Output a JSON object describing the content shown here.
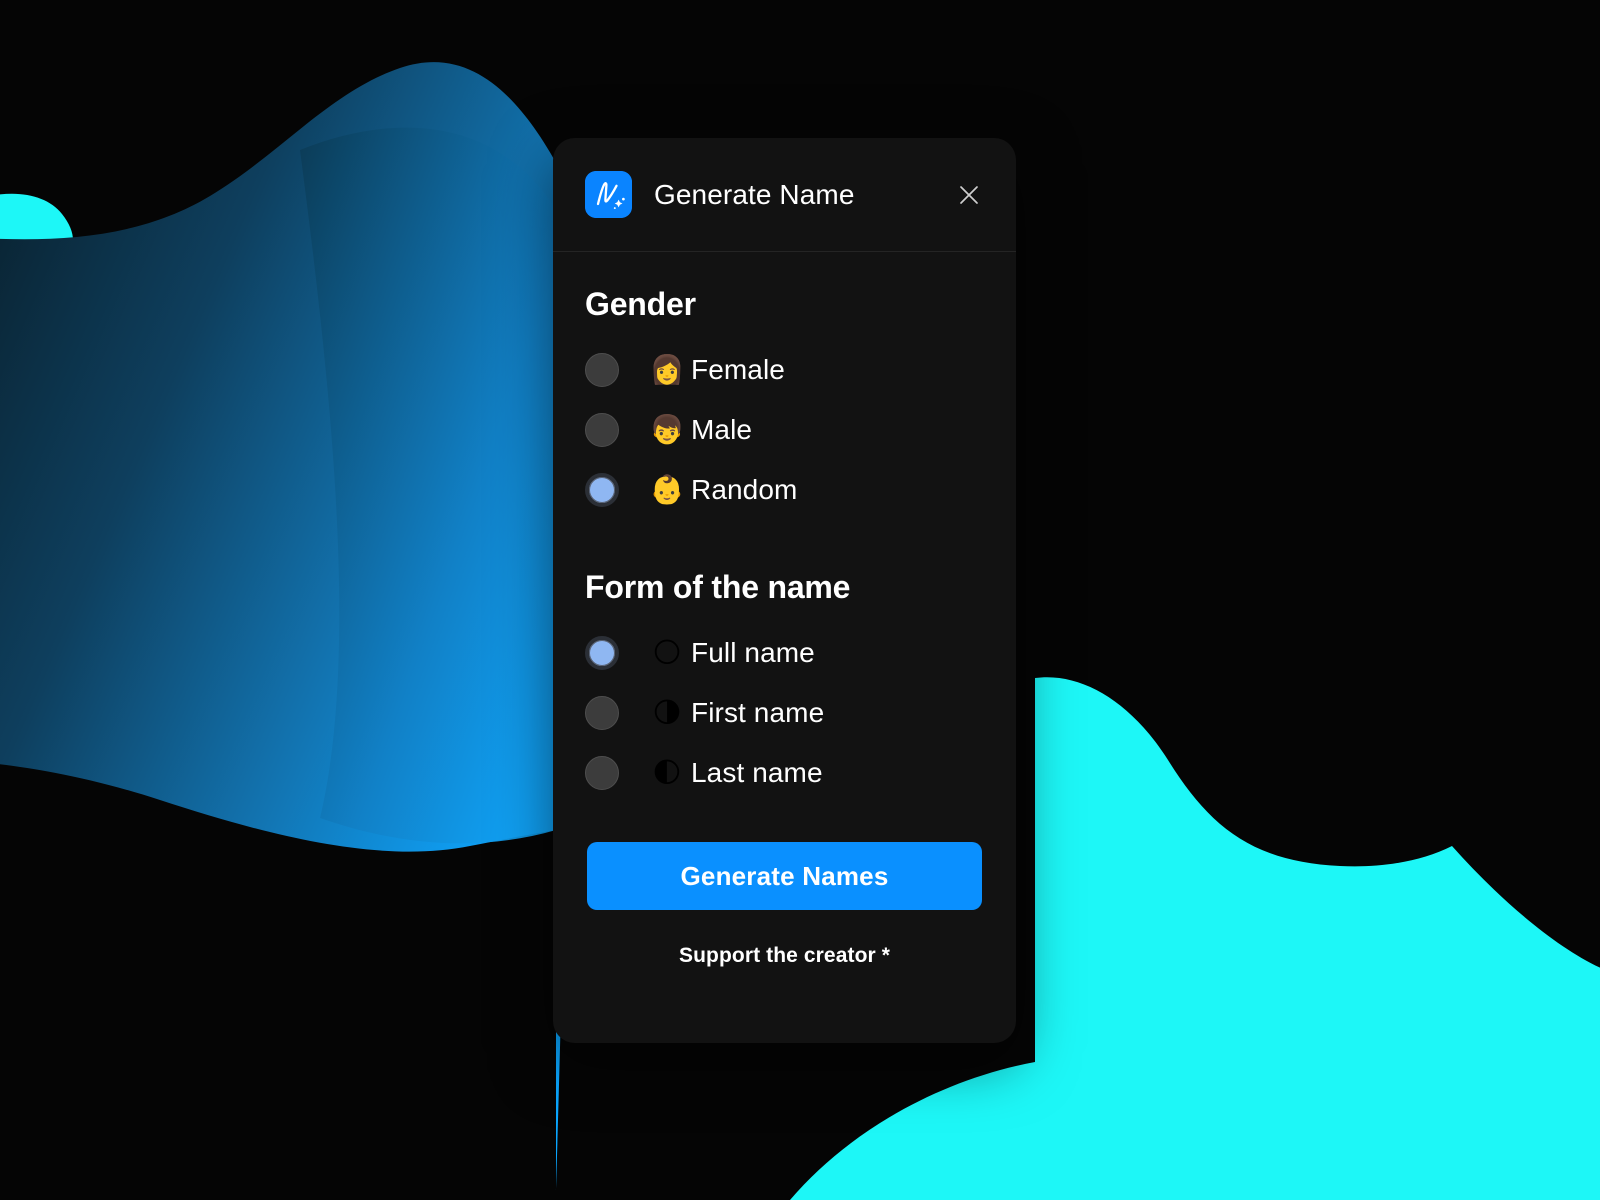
{
  "background": {
    "page_color": "#050505",
    "wave_blue_dark": "#0C2B3E",
    "wave_blue_mid": "#11689F",
    "wave_blue_bright": "#0DA2FF",
    "wave_cyan": "#1DF7F7"
  },
  "panel": {
    "background_color": "#121212",
    "header": {
      "logo_icon": "name-generator-logo-icon",
      "logo_color": "#0A84FF",
      "title": "Generate Name",
      "close_icon": "close-icon"
    },
    "sections": [
      {
        "id": "gender",
        "title": "Gender",
        "options": [
          {
            "emoji": "👩",
            "emoji_name": "woman-emoji",
            "label": "Female",
            "selected": false
          },
          {
            "emoji": "👦",
            "emoji_name": "boy-emoji",
            "label": "Male",
            "selected": false
          },
          {
            "emoji": "👶",
            "emoji_name": "baby-emoji",
            "label": "Random",
            "selected": true
          }
        ]
      },
      {
        "id": "form-of-the-name",
        "title": "Form of the name",
        "options": [
          {
            "emoji": "🌕",
            "emoji_name": "full-moon-emoji",
            "label": "Full name",
            "selected": true
          },
          {
            "emoji": "🌗",
            "emoji_name": "last-quarter-moon-emoji",
            "label": "First name",
            "selected": false
          },
          {
            "emoji": "🌓",
            "emoji_name": "first-quarter-moon-emoji",
            "label": "Last name",
            "selected": false
          }
        ]
      }
    ],
    "primary_button": {
      "label": "Generate Names",
      "color": "#0A90FF"
    },
    "footer_link": {
      "label": "Support the creator *"
    }
  }
}
